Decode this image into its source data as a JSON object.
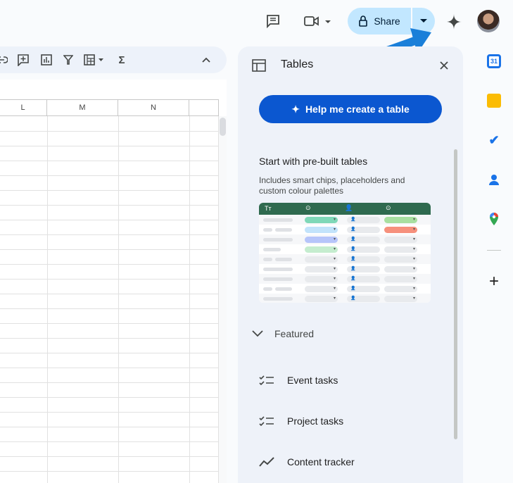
{
  "header": {
    "share_label": "Share"
  },
  "sheet": {
    "columns": [
      "L",
      "M",
      "N"
    ]
  },
  "panel": {
    "title": "Tables",
    "help_button": "Help me create a table",
    "prebuilt_title": "Start with pre-built tables",
    "prebuilt_desc": "Includes smart chips, placeholders and custom colour palettes",
    "preview_rows": [
      {
        "status": "#7fd8b8",
        "status2": "#a8dfa0"
      },
      {
        "status": "#c2e3fb",
        "status2": "#f6907c"
      },
      {
        "status": "#b6c5fa",
        "status2": ""
      },
      {
        "status": "#c5edcf",
        "status2": ""
      },
      {
        "status": "",
        "status2": ""
      },
      {
        "status": "",
        "status2": ""
      },
      {
        "status": "",
        "status2": ""
      },
      {
        "status": "",
        "status2": ""
      },
      {
        "status": "",
        "status2": ""
      }
    ],
    "featured_label": "Featured",
    "items": [
      {
        "label": "Event tasks",
        "icon": "checklist-icon"
      },
      {
        "label": "Project tasks",
        "icon": "checklist-icon"
      },
      {
        "label": "Content tracker",
        "icon": "trend-icon"
      }
    ]
  },
  "colors": {
    "accent": "#0b57d0",
    "share_bg": "#c2e7ff",
    "panel_bg": "#eef2f9",
    "preview_header": "#2f6a4f"
  }
}
